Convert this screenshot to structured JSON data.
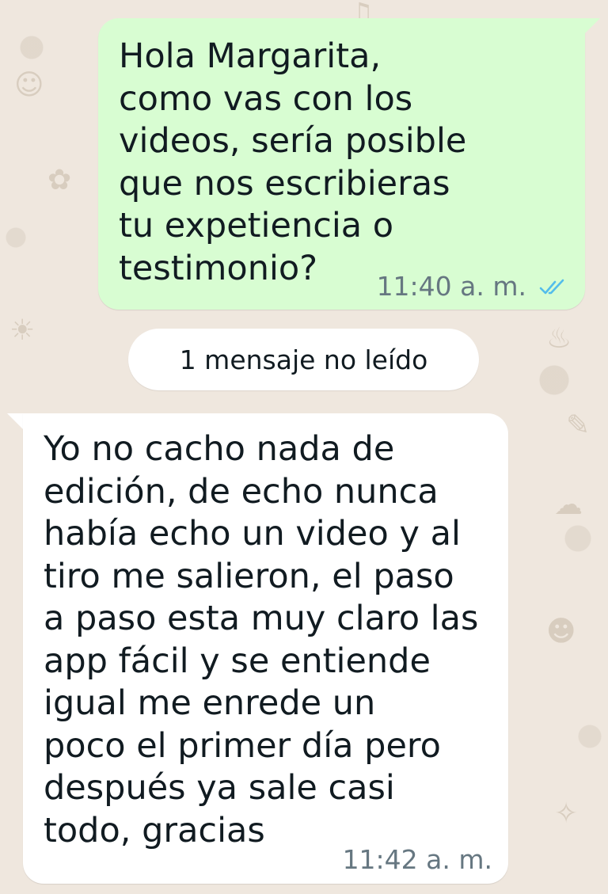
{
  "conversation": {
    "outgoing": {
      "text": "Hola Margarita,\ncomo vas con los\nvideos, sería posible\nque nos escribieras\ntu expetiencia o\ntestimonio?",
      "time": "11:40 a. m.",
      "status_icon": "double-check-read-icon",
      "bubble_color": "#d8fdd2",
      "tick_color": "#53bdeb"
    },
    "unread_divider": {
      "label": "1 mensaje no leído"
    },
    "incoming": {
      "text": "Yo no cacho nada de\nedición, de echo nunca\nhabía echo un video y al\ntiro me salieron, el paso\na paso esta muy claro las\napp fácil y se entiende\nigual me enrede un\npoco el primer día pero\ndespués ya sale casi\ntodo, gracias",
      "time": "11:42 a. m.",
      "bubble_color": "#ffffff"
    }
  },
  "colors": {
    "wallpaper": "#efe7de",
    "text_primary": "#111b21",
    "text_meta": "#667781"
  }
}
